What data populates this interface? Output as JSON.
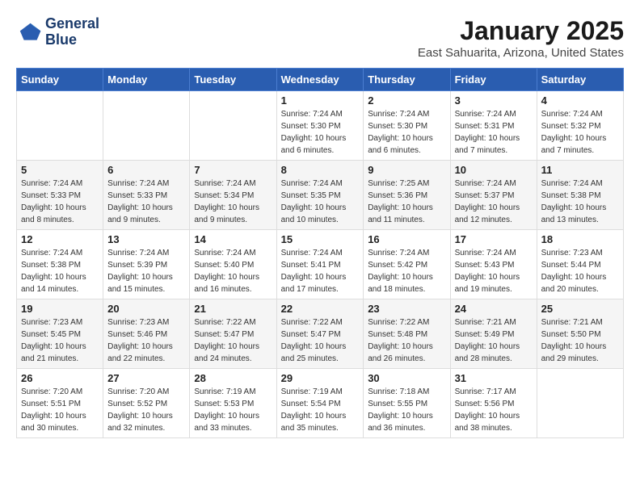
{
  "header": {
    "logo_line1": "General",
    "logo_line2": "Blue",
    "month_title": "January 2025",
    "location": "East Sahuarita, Arizona, United States"
  },
  "weekdays": [
    "Sunday",
    "Monday",
    "Tuesday",
    "Wednesday",
    "Thursday",
    "Friday",
    "Saturday"
  ],
  "weeks": [
    [
      {
        "day": "",
        "info": ""
      },
      {
        "day": "",
        "info": ""
      },
      {
        "day": "",
        "info": ""
      },
      {
        "day": "1",
        "info": "Sunrise: 7:24 AM\nSunset: 5:30 PM\nDaylight: 10 hours\nand 6 minutes."
      },
      {
        "day": "2",
        "info": "Sunrise: 7:24 AM\nSunset: 5:30 PM\nDaylight: 10 hours\nand 6 minutes."
      },
      {
        "day": "3",
        "info": "Sunrise: 7:24 AM\nSunset: 5:31 PM\nDaylight: 10 hours\nand 7 minutes."
      },
      {
        "day": "4",
        "info": "Sunrise: 7:24 AM\nSunset: 5:32 PM\nDaylight: 10 hours\nand 7 minutes."
      }
    ],
    [
      {
        "day": "5",
        "info": "Sunrise: 7:24 AM\nSunset: 5:33 PM\nDaylight: 10 hours\nand 8 minutes."
      },
      {
        "day": "6",
        "info": "Sunrise: 7:24 AM\nSunset: 5:33 PM\nDaylight: 10 hours\nand 9 minutes."
      },
      {
        "day": "7",
        "info": "Sunrise: 7:24 AM\nSunset: 5:34 PM\nDaylight: 10 hours\nand 9 minutes."
      },
      {
        "day": "8",
        "info": "Sunrise: 7:24 AM\nSunset: 5:35 PM\nDaylight: 10 hours\nand 10 minutes."
      },
      {
        "day": "9",
        "info": "Sunrise: 7:25 AM\nSunset: 5:36 PM\nDaylight: 10 hours\nand 11 minutes."
      },
      {
        "day": "10",
        "info": "Sunrise: 7:24 AM\nSunset: 5:37 PM\nDaylight: 10 hours\nand 12 minutes."
      },
      {
        "day": "11",
        "info": "Sunrise: 7:24 AM\nSunset: 5:38 PM\nDaylight: 10 hours\nand 13 minutes."
      }
    ],
    [
      {
        "day": "12",
        "info": "Sunrise: 7:24 AM\nSunset: 5:38 PM\nDaylight: 10 hours\nand 14 minutes."
      },
      {
        "day": "13",
        "info": "Sunrise: 7:24 AM\nSunset: 5:39 PM\nDaylight: 10 hours\nand 15 minutes."
      },
      {
        "day": "14",
        "info": "Sunrise: 7:24 AM\nSunset: 5:40 PM\nDaylight: 10 hours\nand 16 minutes."
      },
      {
        "day": "15",
        "info": "Sunrise: 7:24 AM\nSunset: 5:41 PM\nDaylight: 10 hours\nand 17 minutes."
      },
      {
        "day": "16",
        "info": "Sunrise: 7:24 AM\nSunset: 5:42 PM\nDaylight: 10 hours\nand 18 minutes."
      },
      {
        "day": "17",
        "info": "Sunrise: 7:24 AM\nSunset: 5:43 PM\nDaylight: 10 hours\nand 19 minutes."
      },
      {
        "day": "18",
        "info": "Sunrise: 7:23 AM\nSunset: 5:44 PM\nDaylight: 10 hours\nand 20 minutes."
      }
    ],
    [
      {
        "day": "19",
        "info": "Sunrise: 7:23 AM\nSunset: 5:45 PM\nDaylight: 10 hours\nand 21 minutes."
      },
      {
        "day": "20",
        "info": "Sunrise: 7:23 AM\nSunset: 5:46 PM\nDaylight: 10 hours\nand 22 minutes."
      },
      {
        "day": "21",
        "info": "Sunrise: 7:22 AM\nSunset: 5:47 PM\nDaylight: 10 hours\nand 24 minutes."
      },
      {
        "day": "22",
        "info": "Sunrise: 7:22 AM\nSunset: 5:47 PM\nDaylight: 10 hours\nand 25 minutes."
      },
      {
        "day": "23",
        "info": "Sunrise: 7:22 AM\nSunset: 5:48 PM\nDaylight: 10 hours\nand 26 minutes."
      },
      {
        "day": "24",
        "info": "Sunrise: 7:21 AM\nSunset: 5:49 PM\nDaylight: 10 hours\nand 28 minutes."
      },
      {
        "day": "25",
        "info": "Sunrise: 7:21 AM\nSunset: 5:50 PM\nDaylight: 10 hours\nand 29 minutes."
      }
    ],
    [
      {
        "day": "26",
        "info": "Sunrise: 7:20 AM\nSunset: 5:51 PM\nDaylight: 10 hours\nand 30 minutes."
      },
      {
        "day": "27",
        "info": "Sunrise: 7:20 AM\nSunset: 5:52 PM\nDaylight: 10 hours\nand 32 minutes."
      },
      {
        "day": "28",
        "info": "Sunrise: 7:19 AM\nSunset: 5:53 PM\nDaylight: 10 hours\nand 33 minutes."
      },
      {
        "day": "29",
        "info": "Sunrise: 7:19 AM\nSunset: 5:54 PM\nDaylight: 10 hours\nand 35 minutes."
      },
      {
        "day": "30",
        "info": "Sunrise: 7:18 AM\nSunset: 5:55 PM\nDaylight: 10 hours\nand 36 minutes."
      },
      {
        "day": "31",
        "info": "Sunrise: 7:17 AM\nSunset: 5:56 PM\nDaylight: 10 hours\nand 38 minutes."
      },
      {
        "day": "",
        "info": ""
      }
    ]
  ]
}
